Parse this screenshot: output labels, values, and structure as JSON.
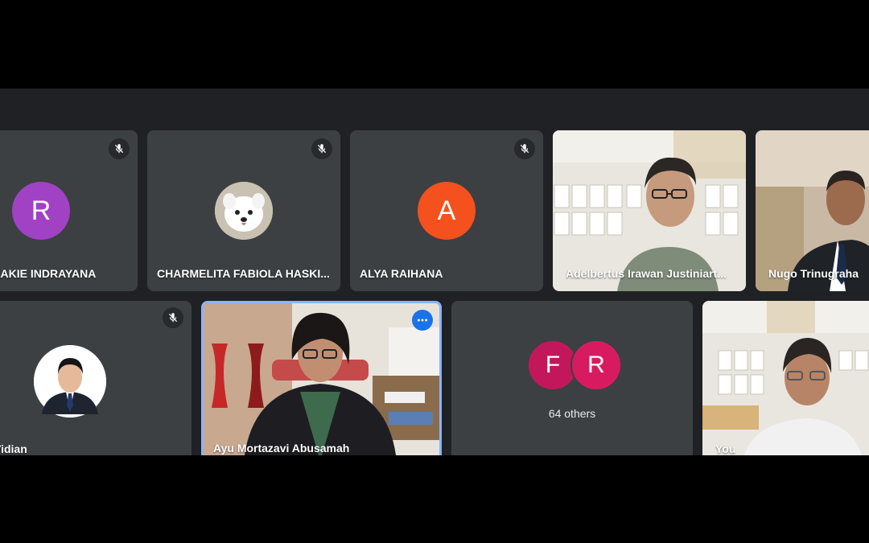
{
  "participants": [
    {
      "name": "ZAKIE INDRAYANA",
      "initial": "R",
      "avatar_color": "#a142c4",
      "muted": true
    },
    {
      "name": "CHARMELITA FABIOLA HASKI...",
      "muted": true
    },
    {
      "name": "ALYA RAIHANA",
      "initial": "A",
      "avatar_color": "#f4511e",
      "muted": true
    },
    {
      "name": "Adelbertus Irawan Justiniart...",
      "muted": false
    },
    {
      "name": "Nugo Trinugraha",
      "muted": false
    },
    {
      "name": "Vidian",
      "muted": true
    },
    {
      "name": "Ayu Mortazavi Abusamah",
      "muted": false,
      "active": true
    },
    {
      "name": "You",
      "muted": false
    }
  ],
  "others_tile": {
    "initials": [
      "F",
      "R"
    ],
    "colors": [
      "#c2185b",
      "#d81b60"
    ],
    "label": "64 others"
  },
  "icons": {
    "mute": "mic-off-icon",
    "more": "more-options-icon"
  }
}
